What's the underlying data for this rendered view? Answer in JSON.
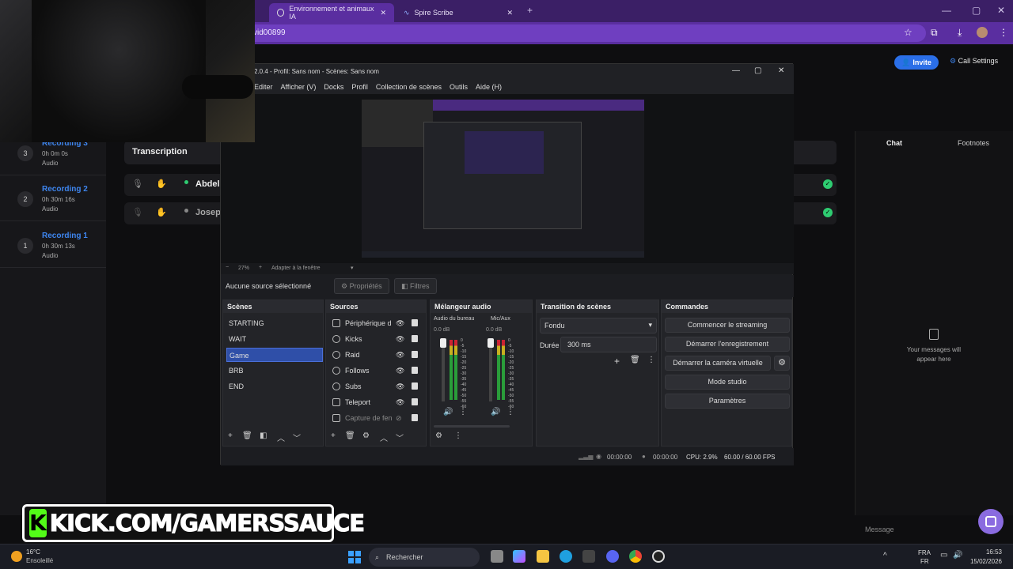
{
  "browser": {
    "tabs": [
      {
        "label": "Environnement et animaux IA"
      },
      {
        "label": "Spire Scribe"
      }
    ],
    "url": "vid00899"
  },
  "app": {
    "invite_label": "Invite",
    "call_settings_label": "Call Settings",
    "recordings": [
      {
        "num": "3",
        "title": "Recording 3",
        "duration": "0h 0m 0s",
        "type": "Audio"
      },
      {
        "num": "2",
        "title": "Recording 2",
        "duration": "0h 30m 16s",
        "type": "Audio"
      },
      {
        "num": "1",
        "title": "Recording 1",
        "duration": "0h 30m 13s",
        "type": "Audio"
      }
    ],
    "transcription_label": "Transcription",
    "participants": [
      {
        "name": "Abdel"
      },
      {
        "name": "Joseph"
      }
    ],
    "chat_tab": "Chat",
    "footnotes_tab": "Footnotes",
    "empty_message": "Your messages will appear here",
    "message_placeholder": "Message"
  },
  "obs": {
    "title": "2.0.4 - Profil: Sans nom - Scènes: Sans nom",
    "menu": [
      "Editer",
      "Afficher (V)",
      "Docks",
      "Profil",
      "Collection de scènes",
      "Outils",
      "Aide (H)"
    ],
    "zoom": "27%",
    "fit_label": "Adapter à la fenêtre",
    "no_source": "Aucune source sélectionné",
    "properties_label": "Propriétés",
    "filters_label": "Filtres",
    "scenes_title": "Scènes",
    "scenes": [
      "STARTING",
      "WAIT",
      "Game",
      "BRB",
      "END"
    ],
    "selected_scene": "Game",
    "sources_title": "Sources",
    "sources": [
      "Périphérique d",
      "Kicks",
      "Raid",
      "Follows",
      "Subs",
      "Teleport",
      "Capture de fen"
    ],
    "mixer_title": "Mélangeur audio",
    "mixer_channels": [
      {
        "name": "Audio du bureau",
        "db": "0.0 dB"
      },
      {
        "name": "Mic/Aux",
        "db": "0.0 dB"
      }
    ],
    "meter_ticks": [
      "0",
      "-5",
      "-10",
      "-15",
      "-20",
      "-25",
      "-30",
      "-35",
      "-40",
      "-45",
      "-50",
      "-55",
      "-60"
    ],
    "transition_title": "Transition de scènes",
    "transition_value": "Fondu",
    "duration_label": "Durée",
    "duration_value": "300 ms",
    "commands_title": "Commandes",
    "commands": [
      "Commencer le streaming",
      "Démarrer l'enregistrement",
      "Démarrer la caméra virtuelle",
      "Mode studio",
      "Paramètres"
    ],
    "status": {
      "stream_time": "00:00:00",
      "rec_time": "00:00:00",
      "cpu": "CPU: 2.9%",
      "fps": "60.00 / 60.00 FPS"
    }
  },
  "overlay": {
    "kick_text": "KICK.COM/GAMERSSAUCE",
    "kick_letter": "K"
  },
  "taskbar": {
    "temp": "16°C",
    "weather": "Ensoleillé",
    "search_placeholder": "Rechercher",
    "lang": "FRA",
    "lang2": "FR",
    "time": "16:53",
    "date": "15/02/2026"
  },
  "colors": {
    "accent_purple": "#5a2ea0",
    "selection_blue": "#2f4fa8",
    "kick_green": "#53fc18",
    "link_blue": "#3e86f0"
  }
}
